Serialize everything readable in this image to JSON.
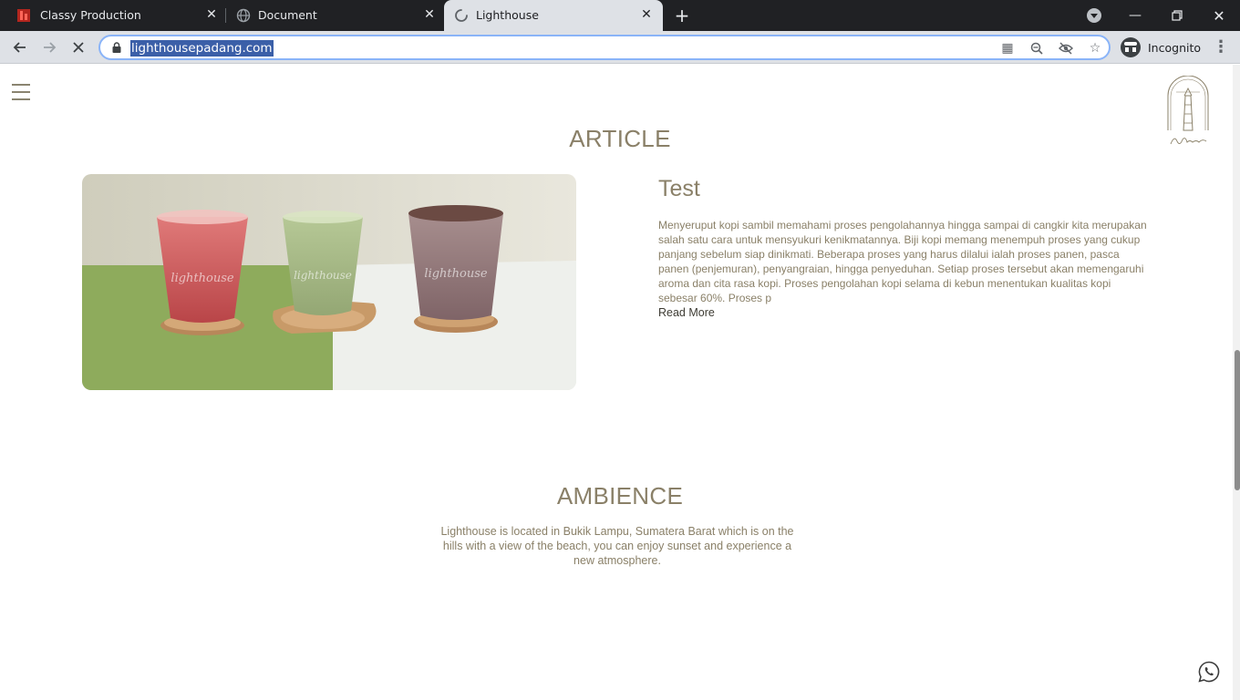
{
  "browser": {
    "tabs": [
      {
        "title": "Classy Production",
        "favicon": "red-logo-icon",
        "active": false
      },
      {
        "title": "Document",
        "favicon": "globe-icon",
        "active": false
      },
      {
        "title": "Lighthouse",
        "favicon": "loading-spinner-icon",
        "active": true
      }
    ],
    "url": "lighthousepadang.com",
    "profile_label": "Incognito",
    "accent_color": "#8ab4f8"
  },
  "page": {
    "article_section_title": "ARTICLE",
    "article": {
      "title": "Test",
      "image_alt": "three iced drinks: strawberry, matcha and chocolate",
      "body": "Menyeruput kopi sambil memahami proses pengolahannya hingga sampai di cangkir kita merupakan salah satu cara untuk mensyukuri kenikmatannya. Biji kopi memang menempuh proses yang cukup panjang sebelum siap dinikmati. Beberapa proses yang harus dilalui ialah proses panen, pasca panen (penjemuran), penyangraian, hingga penyeduhan. Setiap proses tersebut akan memengaruhi aroma dan cita rasa kopi. Proses pengolahan kopi selama di kebun menentukan kualitas kopi sebesar 60%. Proses p",
      "read_more_label": "Read More"
    },
    "ambience_section_title": "AMBIENCE",
    "ambience_text": "Lighthouse is located in Bukik Lampu, Sumatera Barat which is on the hills with a view of the beach, you can enjoy sunset and experience a new atmosphere.",
    "brand_color": "#8a8068"
  }
}
